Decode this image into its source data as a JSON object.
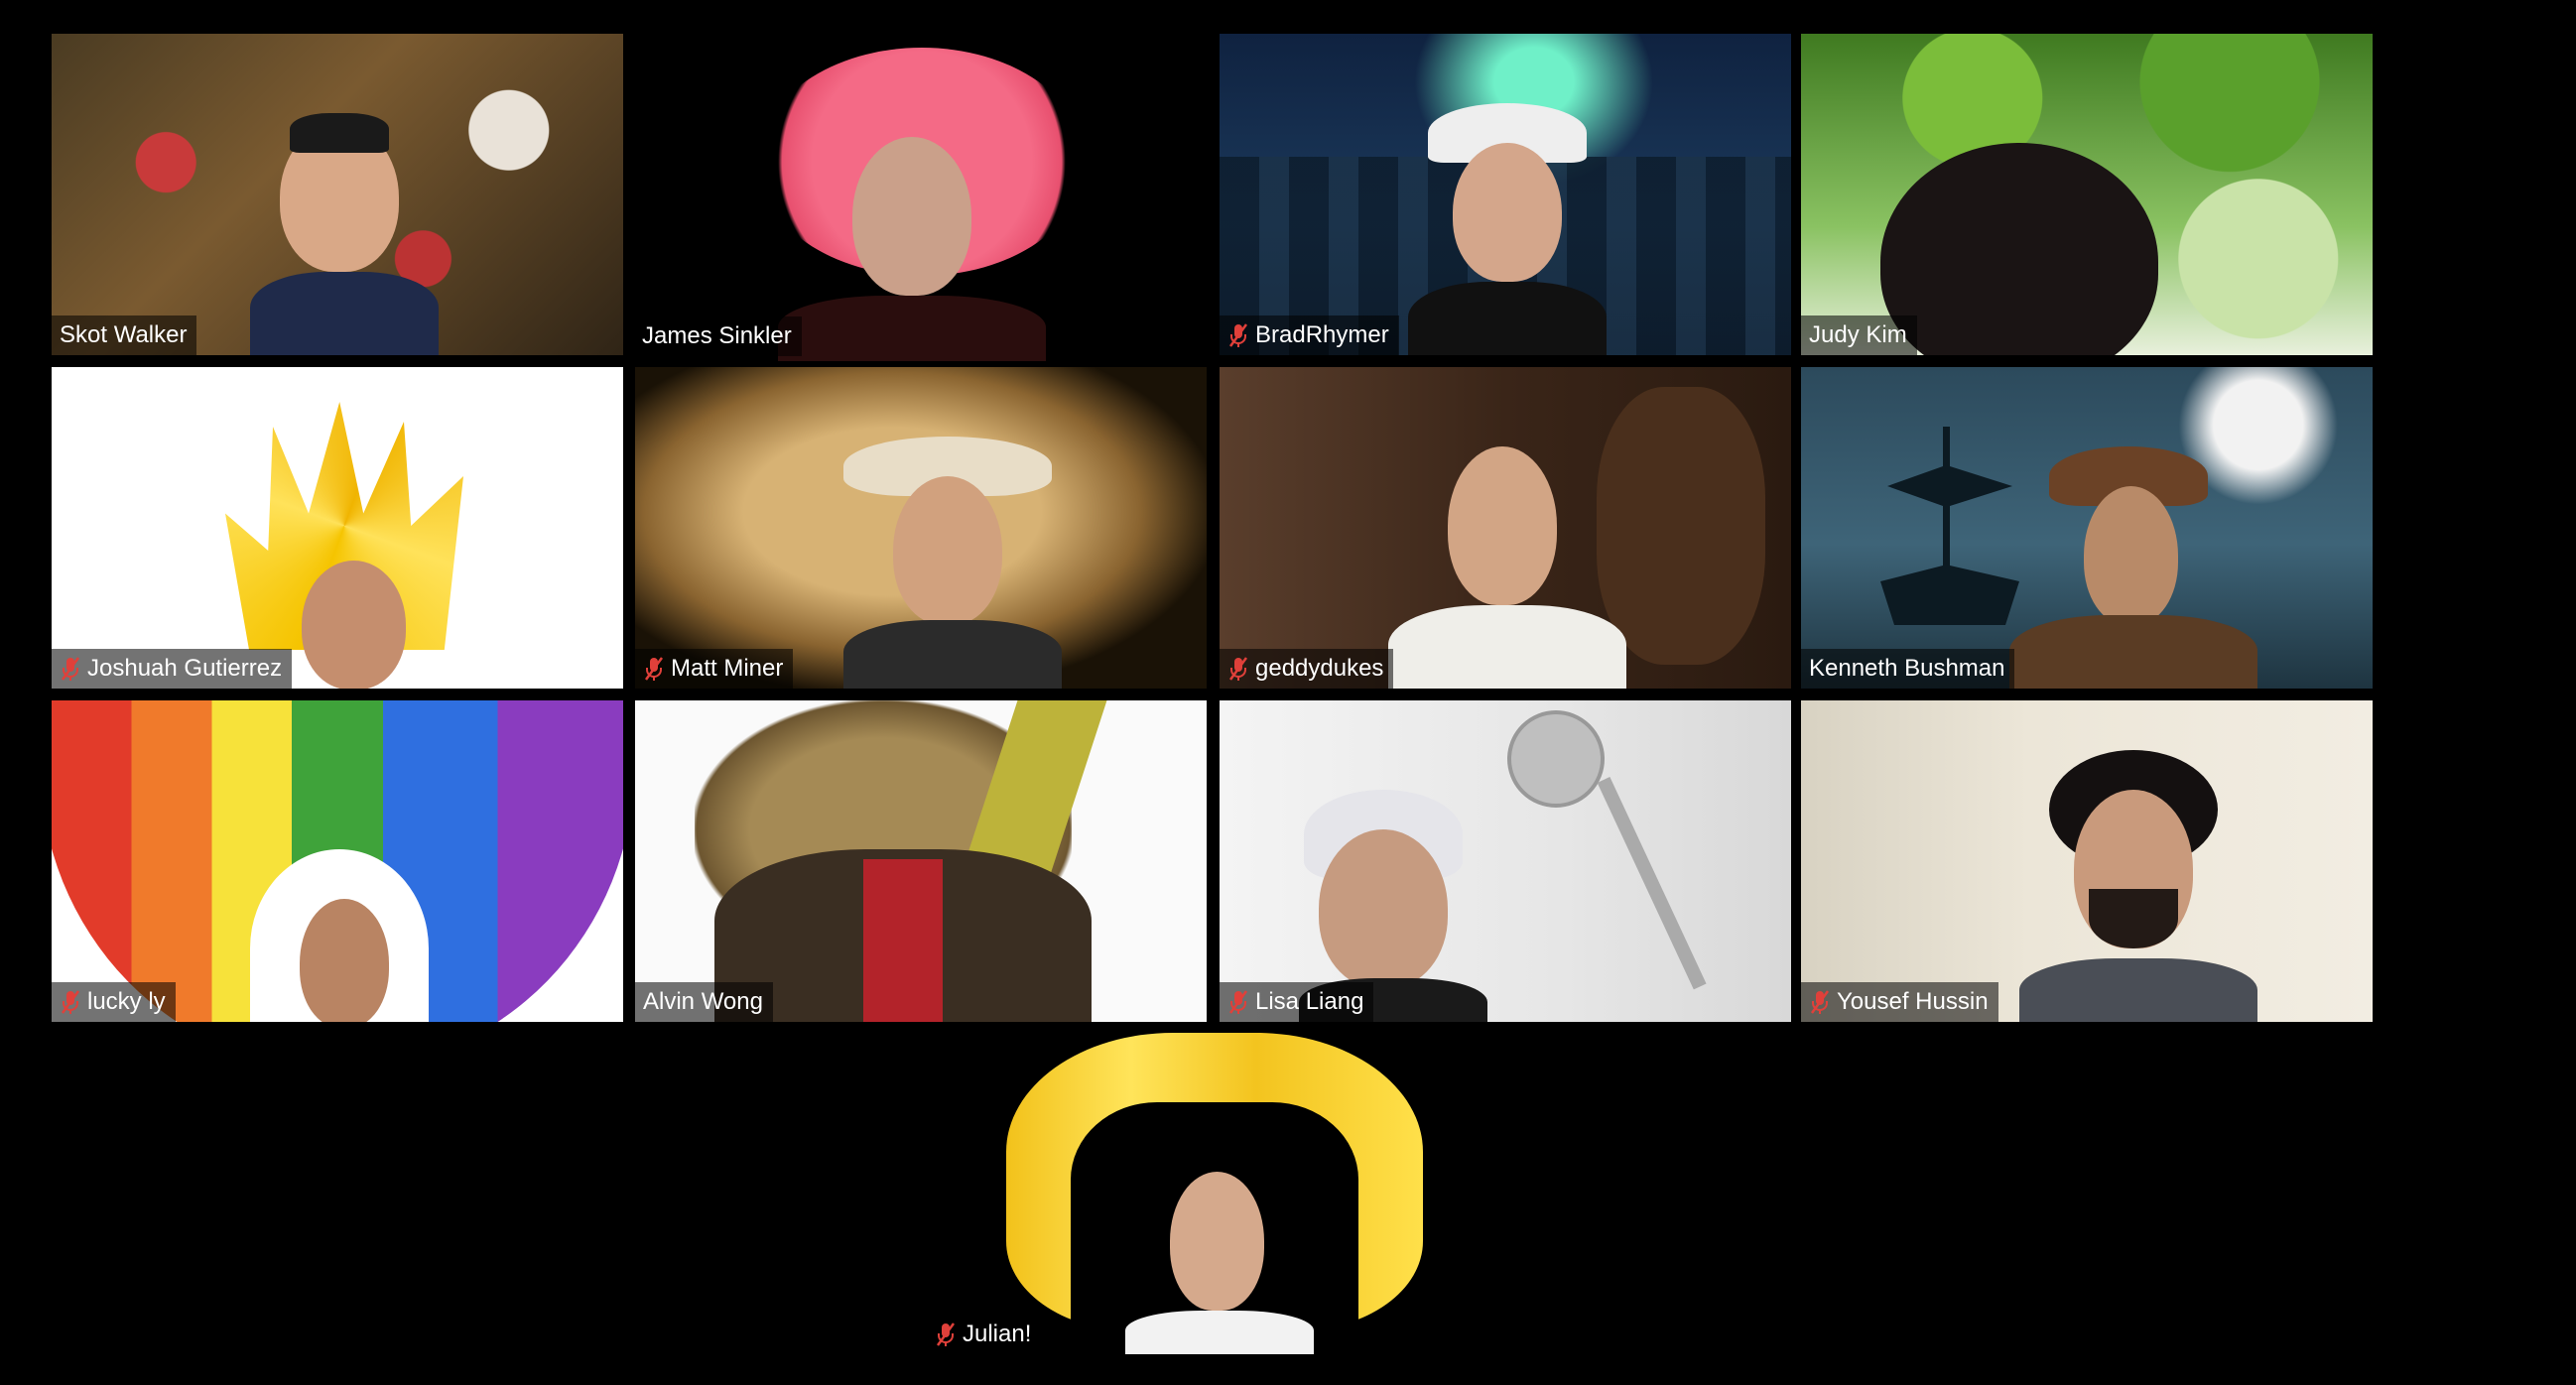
{
  "participants": [
    {
      "name": "Skot Walker",
      "muted": false,
      "active": false,
      "background": "tea-party"
    },
    {
      "name": "James Sinkler",
      "muted": false,
      "active": true,
      "background": "black"
    },
    {
      "name": "BradRhymer",
      "muted": true,
      "active": false,
      "background": "aurora-forest"
    },
    {
      "name": "Judy Kim",
      "muted": false,
      "active": false,
      "background": "leaves"
    },
    {
      "name": "Joshuah Gutierrez",
      "muted": true,
      "active": false,
      "background": "white"
    },
    {
      "name": "Matt Miner",
      "muted": true,
      "active": false,
      "background": "treasure-map"
    },
    {
      "name": "geddydukes",
      "muted": true,
      "active": false,
      "background": "cantina"
    },
    {
      "name": "Kenneth Bushman",
      "muted": false,
      "active": false,
      "background": "pirate-ship-moon"
    },
    {
      "name": "lucky ly",
      "muted": true,
      "active": false,
      "background": "rainbow-wig"
    },
    {
      "name": "Alvin Wong",
      "muted": false,
      "active": false,
      "background": "white"
    },
    {
      "name": "Lisa Liang",
      "muted": true,
      "active": false,
      "background": "shower"
    },
    {
      "name": "Yousef Hussin",
      "muted": true,
      "active": false,
      "background": "plain-wall"
    },
    {
      "name": "Julian!",
      "muted": true,
      "active": false,
      "background": "yellow-wig"
    }
  ],
  "colors": {
    "active_border": "#d9df8a",
    "mute_icon": "#e0403a",
    "label_bg": "rgba(0,0,0,0.55)",
    "page_bg": "#000000"
  }
}
